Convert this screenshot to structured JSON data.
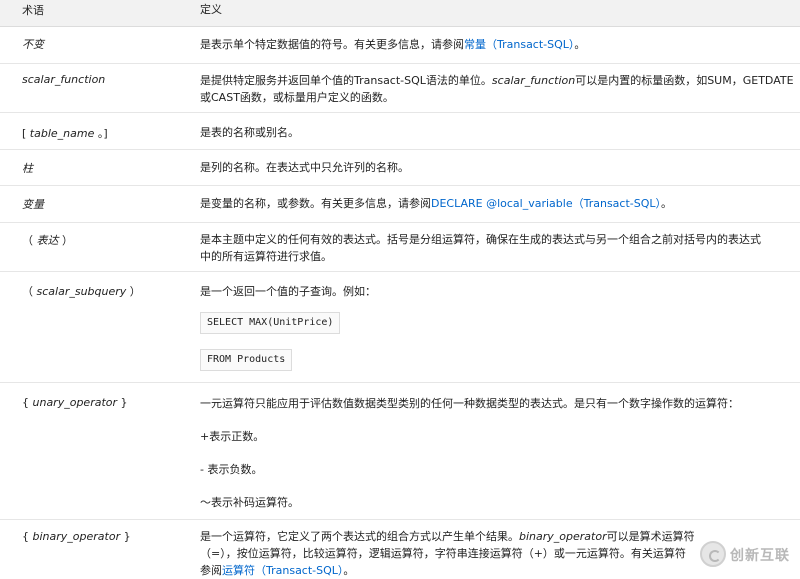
{
  "header": {
    "term": "术语",
    "definition": "定义"
  },
  "rows": [
    {
      "term": "不变",
      "def_a": "是表示单个特定数据值的符号。有关更多信息，请参阅",
      "def_link": "常量（Transact-SQL）",
      "def_b": "。"
    },
    {
      "term": "scalar_function",
      "def_a": "是提供特定服务并返回单个值的Transact-SQL语法的单位。",
      "def_it": "scalar_function",
      "def_b": "可以是内置的标量函数，如SUM，GETDATE",
      "def_c": "或CAST函数，或标量用户定义的函数。"
    },
    {
      "term_a": "[ ",
      "term_it": "table_name",
      "term_b": " 。]",
      "def_a": "是表的名称或别名。"
    },
    {
      "term": "柱",
      "def_a": "是列的名称。在表达式中只允许列的名称。"
    },
    {
      "term": "变量",
      "def_a": "是变量的名称，或参数。有关更多信息，请参阅",
      "def_link": "DECLARE @local_variable（Transact-SQL）",
      "def_b": "。"
    },
    {
      "term_a": "（ ",
      "term_it": "表达",
      "term_b": " ）",
      "def_a": "是本主题中定义的任何有效的表达式。括号是分组运算符，确保在生成的表达式与另一个组合之前对括号内的表达式",
      "def_b": "中的所有运算符进行求值。"
    },
    {
      "term_a": "（ ",
      "term_it": "scalar_subquery",
      "term_b": " ）",
      "def_a": "是一个返回一个值的子查询。例如：",
      "code_1": "SELECT MAX(UnitPrice)",
      "code_2": "FROM Products"
    },
    {
      "term_a": "{ ",
      "term_it": "unary_operator",
      "term_b": " }",
      "def_a": "一元运算符只能应用于评估数值数据类型类别的任何一种数据类型的表达式。是只有一个数字操作数的运算符：",
      "line_1": "+表示正数。",
      "line_2": "- 表示负数。",
      "line_3": "〜表示补码运算符。"
    },
    {
      "term_a": "{ ",
      "term_it": "binary_operator",
      "term_b": " }",
      "def_a": "是一个运算符，它定义了两个表达式的组合方式以产生单个结果。",
      "def_it": "binary_operator",
      "def_b": "可以是算术运算符",
      "def_c": "（=），按位运算符，比较运算符，逻辑运算符，字符串连接运算符（+）或一元运算符。有关运算符",
      "def_d_a": "参阅",
      "def_link": "运算符（Transact-SQL）",
      "def_d_b": "。"
    }
  ],
  "watermark": {
    "text": "创新互联"
  }
}
